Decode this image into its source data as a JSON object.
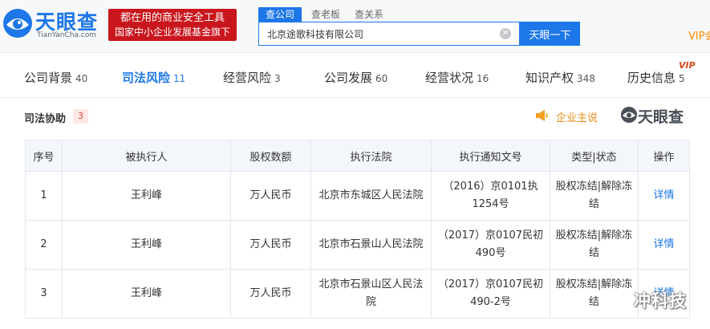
{
  "brand": {
    "name": "天眼查",
    "domain": "TianYanCha.com",
    "banner_line1": "都在用的商业安全工具",
    "banner_line2": "国家中小企业发展基金旗下",
    "accent": "#1d77e8",
    "banner_color": "#c9161d"
  },
  "search": {
    "tabs": [
      "查公司",
      "查老板",
      "查关系"
    ],
    "value": "北京途歌科技有限公司",
    "button_label": "天眼一下",
    "clear_icon": "close-circle-icon"
  },
  "header_vip": "VIP会",
  "nav": {
    "items": [
      {
        "label": "公司背景",
        "count": "40"
      },
      {
        "label": "司法风险",
        "count": "11"
      },
      {
        "label": "经营风险",
        "count": "3"
      },
      {
        "label": "公司发展",
        "count": "60"
      },
      {
        "label": "经营状况",
        "count": "16"
      },
      {
        "label": "知识产权",
        "count": "348"
      },
      {
        "label": "历史信息",
        "count": "5"
      }
    ],
    "active_index": 1,
    "vip_badge": "VIP"
  },
  "section": {
    "title": "司法协助",
    "count": "3",
    "speak_label": "企业主说",
    "speak_icon": "megaphone-icon",
    "brand_text": "天眼查"
  },
  "table": {
    "headers": [
      "序号",
      "被执行人",
      "股权数额",
      "执行法院",
      "执行通知文号",
      "类型|状态",
      "操作"
    ],
    "rows": [
      [
        "1",
        "王利峰",
        "万人民币",
        "北京市东城区人民法院",
        "（2016）京0101执1254号",
        "股权冻结|解除冻结",
        "详情"
      ],
      [
        "2",
        "王利峰",
        "万人民币",
        "北京市石景山人民法院",
        "（2017）京0107民初490号",
        "股权冻结|解除冻结",
        "详情"
      ],
      [
        "3",
        "王利峰",
        "万人民币",
        "北京市石景山区人民法院",
        "（2017）京0107民初490-2号",
        "股权冻结|解除冻结",
        "详情"
      ]
    ]
  },
  "watermark": {
    "text": "冲科技",
    "icon": "wechat-icon"
  }
}
